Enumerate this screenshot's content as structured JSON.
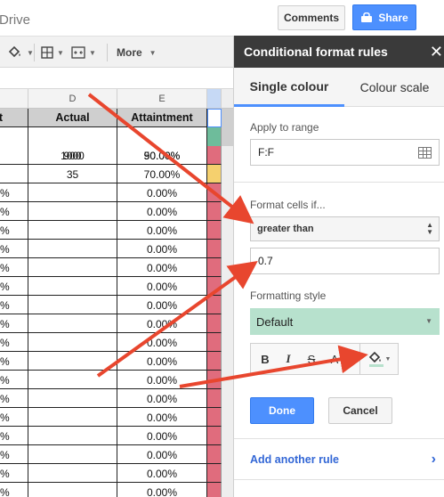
{
  "topbar": {
    "drive_text": "Drive",
    "comments_label": "Comments",
    "share_label": "Share"
  },
  "toolbar": {
    "more_label": "More"
  },
  "columns": {
    "d": "D",
    "e": "E"
  },
  "table": {
    "headers": {
      "a": "t",
      "d": "Actual",
      "e": "Attaintment"
    },
    "rows": [
      {
        "a": "",
        "d": "900",
        "e": "90.00%",
        "f": "#6ebc9b"
      },
      {
        "a": "",
        "d": "1000",
        "e": "50.00%",
        "f": "#e06c7d"
      },
      {
        "a": "",
        "d": "35",
        "e": "70.00%",
        "f": "#f5d06e"
      },
      {
        "a": "%",
        "d": "",
        "e": "0.00%",
        "f": "#e06c7d"
      },
      {
        "a": "%",
        "d": "",
        "e": "0.00%",
        "f": "#e06c7d"
      },
      {
        "a": "%",
        "d": "",
        "e": "0.00%",
        "f": "#e06c7d"
      },
      {
        "a": "%",
        "d": "",
        "e": "0.00%",
        "f": "#e06c7d"
      },
      {
        "a": "%",
        "d": "",
        "e": "0.00%",
        "f": "#e06c7d"
      },
      {
        "a": "%",
        "d": "",
        "e": "0.00%",
        "f": "#e06c7d"
      },
      {
        "a": "%",
        "d": "",
        "e": "0.00%",
        "f": "#e06c7d"
      },
      {
        "a": "%",
        "d": "",
        "e": "0.00%",
        "f": "#e06c7d"
      },
      {
        "a": "%",
        "d": "",
        "e": "0.00%",
        "f": "#e06c7d"
      },
      {
        "a": "%",
        "d": "",
        "e": "0.00%",
        "f": "#e06c7d"
      },
      {
        "a": "%",
        "d": "",
        "e": "0.00%",
        "f": "#e06c7d"
      },
      {
        "a": "%",
        "d": "",
        "e": "0.00%",
        "f": "#e06c7d"
      },
      {
        "a": "%",
        "d": "",
        "e": "0.00%",
        "f": "#e06c7d"
      },
      {
        "a": "%",
        "d": "",
        "e": "0.00%",
        "f": "#e06c7d"
      },
      {
        "a": "%",
        "d": "",
        "e": "0.00%",
        "f": "#e06c7d"
      },
      {
        "a": "%",
        "d": "",
        "e": "0.00%",
        "f": "#e06c7d"
      },
      {
        "a": "%",
        "d": "",
        "e": "0.00%",
        "f": "#e06c7d"
      }
    ]
  },
  "panel": {
    "title": "Conditional format rules",
    "tabs": [
      "Single colour",
      "Colour scale"
    ],
    "apply_label": "Apply to range",
    "range_value": "F:F",
    "format_if_label": "Format cells if...",
    "condition": "greater than",
    "condition_value": "0.7",
    "style_label": "Formatting style",
    "style_value": "Default",
    "fmt_bold": "B",
    "fmt_italic": "I",
    "fmt_strike": "S",
    "fmt_text_color": "A",
    "done_label": "Done",
    "cancel_label": "Cancel",
    "add_rule_label": "Add another rule"
  },
  "colors": {
    "accent": "#4d90fe",
    "header_bg": "#3a3a3a",
    "style_fill": "#b7e1cd",
    "arrow": "#e8462e",
    "link": "#3367d6"
  }
}
